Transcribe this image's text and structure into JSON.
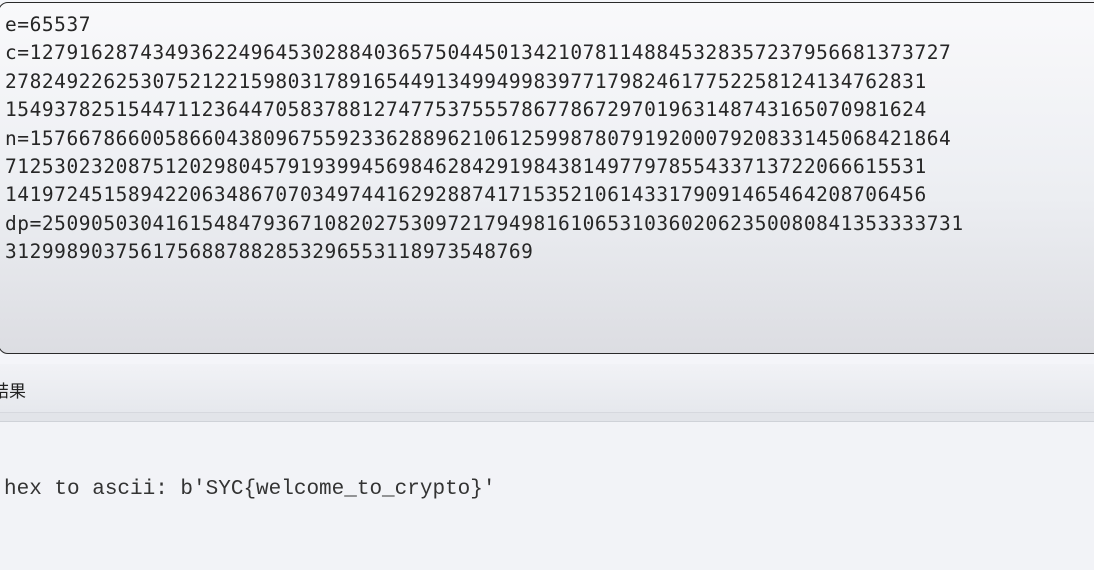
{
  "input": {
    "lines": [
      "e=65537",
      "c=127916287434936224964530288403657504450134210781148845328357237956681373727",
      "278249226253075212215980317891654491349949983977179824617752258124134762831",
      "154937825154471123644705837881274775375557867786729701963148743165070981624",
      "n=157667866005866043809675592336288962106125998780791920007920833145068421864",
      "712530232087512029804579193994569846284291984381497797855433713722066615531",
      "141972451589422063486707034974416292887417153521061433179091465464208706456",
      "dp=250905030416154847936710820275309721794981610653103602062350080841353333731",
      "31299890375617568878828532965531189735487​69"
    ]
  },
  "result": {
    "header_label": "结果",
    "output": "hex to ascii: b'SYC{welcome_to_crypto}'"
  }
}
